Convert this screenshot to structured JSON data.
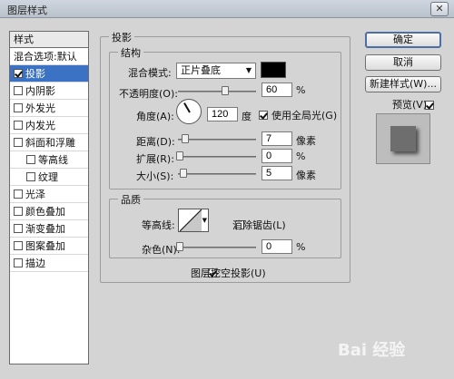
{
  "title": "图层样式",
  "close_glyph": "✕",
  "styles_list": {
    "header": "样式",
    "items": [
      {
        "label": "混合选项:默认",
        "check": false,
        "has_checkbox": false,
        "selected": false,
        "sub": false
      },
      {
        "label": "投影",
        "check": true,
        "has_checkbox": true,
        "selected": true,
        "sub": false
      },
      {
        "label": "内阴影",
        "check": false,
        "has_checkbox": true,
        "selected": false,
        "sub": false
      },
      {
        "label": "外发光",
        "check": false,
        "has_checkbox": true,
        "selected": false,
        "sub": false
      },
      {
        "label": "内发光",
        "check": false,
        "has_checkbox": true,
        "selected": false,
        "sub": false
      },
      {
        "label": "斜面和浮雕",
        "check": false,
        "has_checkbox": true,
        "selected": false,
        "sub": false
      },
      {
        "label": "等高线",
        "check": false,
        "has_checkbox": true,
        "selected": false,
        "sub": true
      },
      {
        "label": "纹理",
        "check": false,
        "has_checkbox": true,
        "selected": false,
        "sub": true
      },
      {
        "label": "光泽",
        "check": false,
        "has_checkbox": true,
        "selected": false,
        "sub": false
      },
      {
        "label": "颜色叠加",
        "check": false,
        "has_checkbox": true,
        "selected": false,
        "sub": false
      },
      {
        "label": "渐变叠加",
        "check": false,
        "has_checkbox": true,
        "selected": false,
        "sub": false
      },
      {
        "label": "图案叠加",
        "check": false,
        "has_checkbox": true,
        "selected": false,
        "sub": false
      },
      {
        "label": "描边",
        "check": false,
        "has_checkbox": true,
        "selected": false,
        "sub": false
      }
    ]
  },
  "panel_title": "投影",
  "structure": {
    "legend": "结构",
    "blend_mode_label": "混合模式:",
    "blend_mode_value": "正片叠底",
    "blend_color": "#000000",
    "opacity_label": "不透明度(O):",
    "opacity_value": "60",
    "opacity_level": 0.6,
    "pct": "%",
    "angle_label": "角度(A):",
    "angle_value": "120",
    "angle_unit": "度",
    "global_light_label": "使用全局光(G)",
    "global_light_checked": true,
    "distance_label": "距离(D):",
    "distance_value": "7",
    "distance_unit": "像素",
    "spread_label": "扩展(R):",
    "spread_value": "0",
    "size_label": "大小(S):",
    "size_value": "5",
    "size_unit": "像素"
  },
  "quality": {
    "legend": "品质",
    "contour_label": "等高线:",
    "antialias_label": "消除锯齿(L)",
    "antialias_checked": false,
    "noise_label": "杂色(N):",
    "noise_value": "0",
    "pct": "%"
  },
  "knockout_label": "图层挖空投影(U)",
  "knockout_checked": true,
  "buttons": {
    "ok": "确定",
    "cancel": "取消",
    "new_style": "新建样式(W)...",
    "preview_label": "预览(V)",
    "preview_checked": true
  },
  "watermark": "Bai 经验"
}
